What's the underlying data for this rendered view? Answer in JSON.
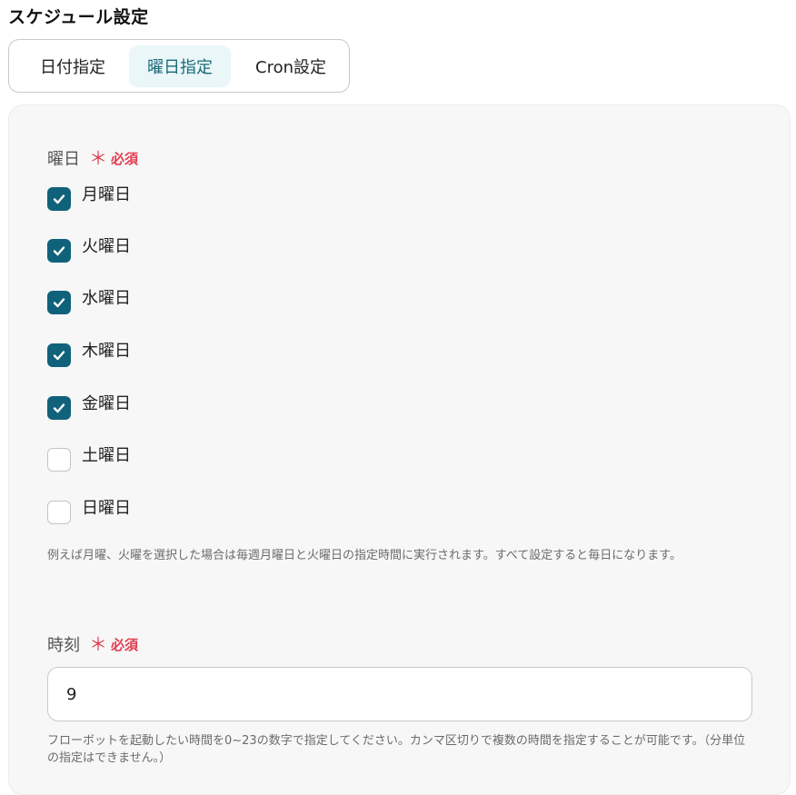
{
  "page": {
    "title": "スケジュール設定"
  },
  "tabs": [
    {
      "label": "日付指定",
      "selected": false
    },
    {
      "label": "曜日指定",
      "selected": true
    },
    {
      "label": "Cron設定",
      "selected": false
    }
  ],
  "weekday_field": {
    "label": "曜日",
    "required_mark": "＊",
    "required_text": "必須",
    "options": [
      {
        "label": "月曜日",
        "checked": true
      },
      {
        "label": "火曜日",
        "checked": true
      },
      {
        "label": "水曜日",
        "checked": true
      },
      {
        "label": "木曜日",
        "checked": true
      },
      {
        "label": "金曜日",
        "checked": true
      },
      {
        "label": "土曜日",
        "checked": false
      },
      {
        "label": "日曜日",
        "checked": false
      }
    ],
    "help": "例えば月曜、火曜を選択した場合は毎週月曜日と火曜日の指定時間に実行されます。すべて設定すると毎日になります。"
  },
  "time_field": {
    "label": "時刻",
    "required_mark": "＊",
    "required_text": "必須",
    "value": "9",
    "help": "フローボットを起動したい時間を0~23の数字で指定してください。カンマ区切りで複数の時間を指定することが可能です。（分単位の指定はできません。）"
  },
  "colors": {
    "accent": "#10627a",
    "tab_selected_bg": "#eaf6f7",
    "required": "#e23d4f",
    "panel_bg": "#f7f7f7"
  }
}
